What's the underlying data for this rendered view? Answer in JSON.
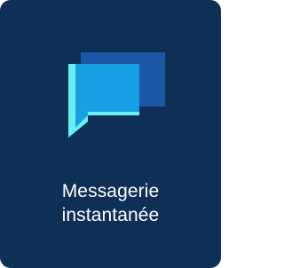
{
  "tile": {
    "label_line1": "Messagerie",
    "label_line2": "instantanée",
    "icon": "chat-bubbles-icon"
  },
  "colors": {
    "tile_background": "#0f3056",
    "bubble_back": "#1c57a6",
    "bubble_front": "#17a1e5",
    "bubble_accent": "#66f0f4",
    "text": "#ffffff"
  }
}
